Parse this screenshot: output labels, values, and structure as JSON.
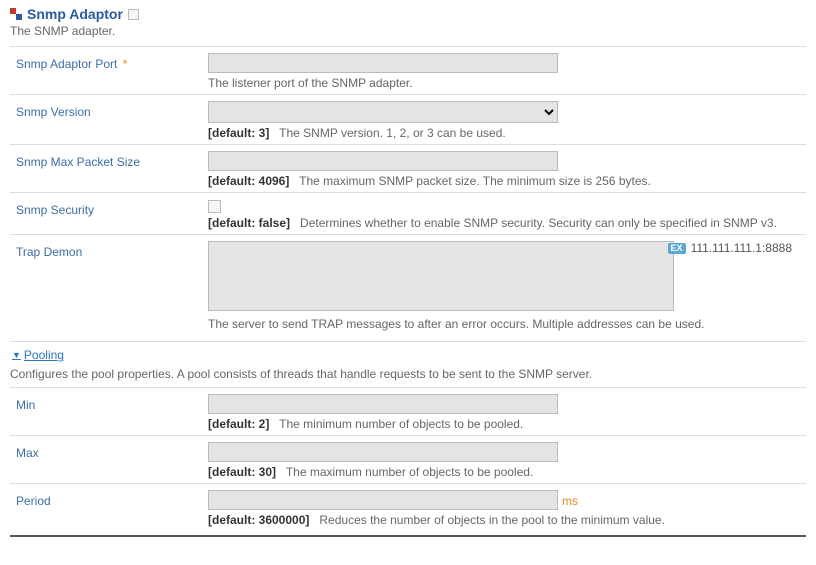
{
  "header": {
    "title": "Snmp Adaptor",
    "subtitle": "The SNMP adapter."
  },
  "fields": {
    "port": {
      "label": "Snmp Adaptor Port",
      "required_mark": "*",
      "value": "",
      "help": "The listener port of the SNMP adapter."
    },
    "version": {
      "label": "Snmp Version",
      "value": "",
      "default": "[default: 3]",
      "help": "The SNMP version. 1, 2, or 3 can be used."
    },
    "maxpkt": {
      "label": "Snmp Max Packet Size",
      "value": "",
      "default": "[default: 4096]",
      "help": "The maximum SNMP packet size. The minimum size is 256 bytes."
    },
    "security": {
      "label": "Snmp Security",
      "default": "[default: false]",
      "help": "Determines whether to enable SNMP security. Security can only be specified in SNMP v3."
    },
    "trap": {
      "label": "Trap Demon",
      "value": "",
      "help": "The server to send TRAP messages to after an error occurs. Multiple addresses can be used.",
      "example_badge": "EX",
      "example": "111.111.111.1:8888"
    }
  },
  "pooling": {
    "heading": "Pooling",
    "desc": "Configures the pool properties. A pool consists of threads that handle requests to be sent to the SNMP server.",
    "min": {
      "label": "Min",
      "value": "",
      "default": "[default: 2]",
      "help": "The minimum number of objects to be pooled."
    },
    "max": {
      "label": "Max",
      "value": "",
      "default": "[default: 30]",
      "help": "The maximum number of objects to be pooled."
    },
    "period": {
      "label": "Period",
      "value": "",
      "unit": "ms",
      "default": "[default: 3600000]",
      "help": "Reduces the number of objects in the pool to the minimum value."
    }
  }
}
